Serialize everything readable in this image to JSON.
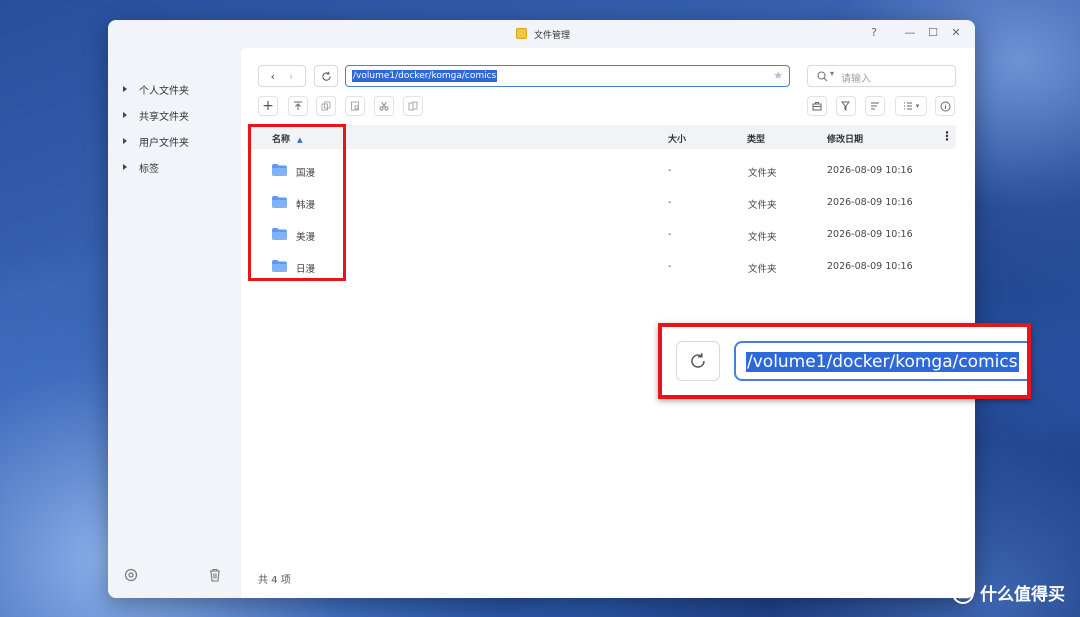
{
  "window": {
    "title": "文件管理",
    "controls": {
      "help": "?",
      "minimize": "—",
      "maximize": "☐",
      "close": "✕"
    }
  },
  "sidebar": {
    "items": [
      {
        "label": "个人文件夹"
      },
      {
        "label": "共享文件夹"
      },
      {
        "label": "用户文件夹"
      },
      {
        "label": "标签"
      }
    ]
  },
  "toolbar": {
    "path": "/volume1/docker/komga/comics",
    "search_placeholder": "请输入"
  },
  "table": {
    "columns": {
      "name": "名称",
      "size": "大小",
      "type": "类型",
      "modified": "修改日期"
    },
    "rows": [
      {
        "name": "国漫",
        "size": "-",
        "type": "文件夹",
        "modified": "2026-08-09 10:16"
      },
      {
        "name": "韩漫",
        "size": "-",
        "type": "文件夹",
        "modified": "2026-08-09 10:16"
      },
      {
        "name": "美漫",
        "size": "-",
        "type": "文件夹",
        "modified": "2026-08-09 10:16"
      },
      {
        "name": "日漫",
        "size": "-",
        "type": "文件夹",
        "modified": "2026-08-09 10:16"
      }
    ]
  },
  "footer": {
    "count": "共 4 项"
  },
  "zoom_callout": {
    "path": "/volume1/docker/komga/comics"
  },
  "watermark": {
    "logo": "值",
    "text": "什么值得买"
  },
  "colors": {
    "accent": "#2f68d8",
    "highlight": "#e8141a",
    "folder": "#5b9bf0"
  }
}
